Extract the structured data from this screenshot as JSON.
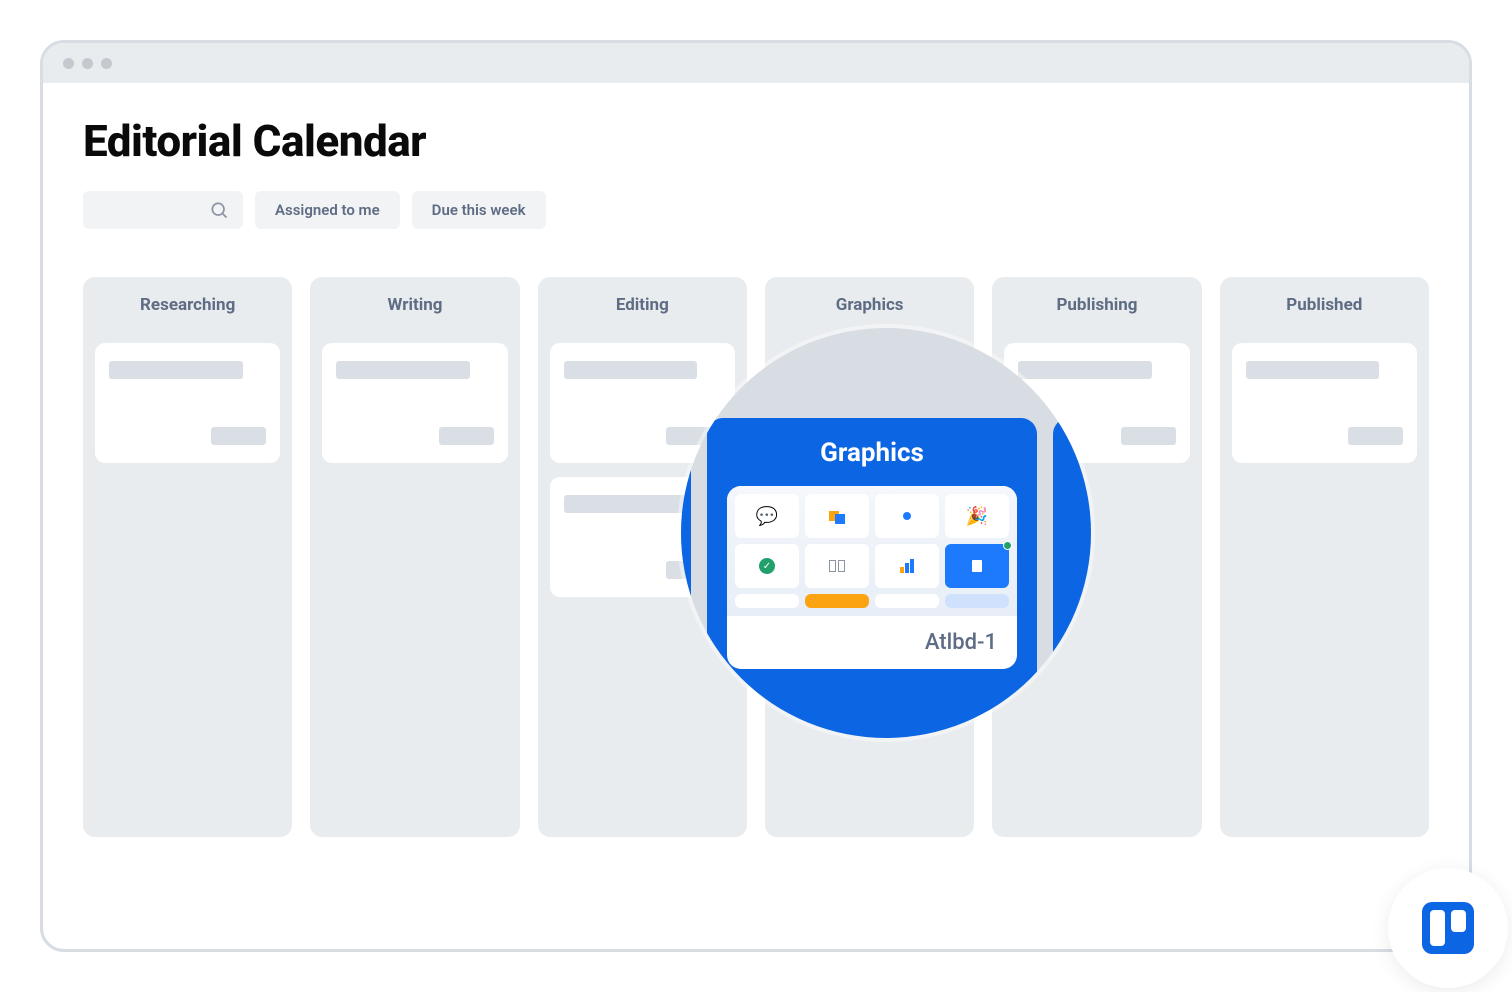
{
  "page": {
    "title": "Editorial Calendar"
  },
  "filters": [
    {
      "label": "Assigned to me"
    },
    {
      "label": "Due this week"
    }
  ],
  "columns": [
    {
      "title": "Researching",
      "cards": 1
    },
    {
      "title": "Writing",
      "cards": 1
    },
    {
      "title": "Editing",
      "cards": 2
    },
    {
      "title": "Graphics",
      "cards": 0
    },
    {
      "title": "Publishing",
      "cards": 1
    },
    {
      "title": "Published",
      "cards": 1
    }
  ],
  "magnified": {
    "column_title": "Graphics",
    "card_label": "Atlbd-1"
  },
  "app_icon": "trello"
}
